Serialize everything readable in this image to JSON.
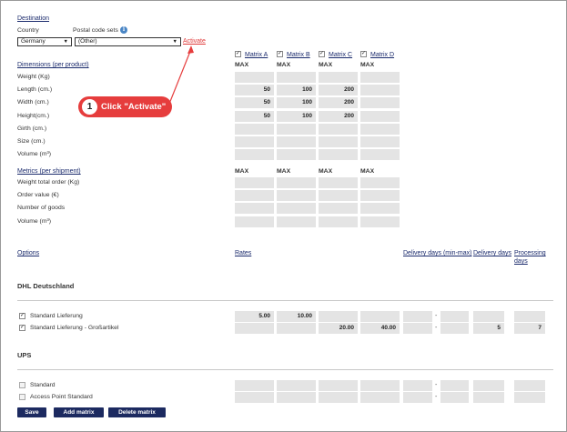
{
  "destination": {
    "title": "Destination",
    "country_label": "Country",
    "postal_label": "Postal code sets",
    "country_value": "Germany",
    "postal_value": "(Other)",
    "activate_link": "Activate",
    "info_icon": "i"
  },
  "callout": {
    "number": "1",
    "text": "Click \"Activate\""
  },
  "matrices": [
    "Matrix A",
    "Matrix B",
    "Matrix C",
    "Matrix D"
  ],
  "max_label": "MAX",
  "dimensions": {
    "title": "Dimensions (per product)",
    "rows": [
      {
        "label": "Weight (Kg)",
        "values": [
          "",
          "",
          "",
          ""
        ]
      },
      {
        "label": "Length (cm.)",
        "values": [
          "50",
          "100",
          "200",
          ""
        ]
      },
      {
        "label": "Width (cm.)",
        "values": [
          "50",
          "100",
          "200",
          ""
        ]
      },
      {
        "label": "Height(cm.)",
        "values": [
          "50",
          "100",
          "200",
          ""
        ]
      },
      {
        "label": "Girth (cm.)",
        "values": [
          "",
          "",
          "",
          ""
        ]
      },
      {
        "label": "Size (cm.)",
        "values": [
          "",
          "",
          "",
          ""
        ]
      },
      {
        "label": "Volume (m³)",
        "values": [
          "",
          "",
          "",
          ""
        ]
      }
    ]
  },
  "metrics": {
    "title": "Metrics (per shipment)",
    "rows": [
      {
        "label": "Weight total order (Kg)",
        "values": [
          "",
          "",
          "",
          ""
        ]
      },
      {
        "label": "Order value (€)",
        "values": [
          "",
          "",
          "",
          ""
        ]
      },
      {
        "label": "Number of goods",
        "values": [
          "",
          "",
          "",
          ""
        ]
      },
      {
        "label": "Volume (m³)",
        "values": [
          "",
          "",
          "",
          ""
        ]
      }
    ]
  },
  "options_header": {
    "options": "Options",
    "rates": "Rates",
    "delivery_min_max": "Delivery days (min-max)",
    "delivery_days": "Delivery days",
    "processing_line1": "Processing",
    "processing_line2": "days"
  },
  "carriers": [
    {
      "name": "DHL Deutschland",
      "services": [
        {
          "label": "Standard Lieferung",
          "checked": true,
          "rates": [
            "5.00",
            "10.00",
            "",
            ""
          ],
          "min": "",
          "max": "",
          "delivery": "",
          "processing": ""
        },
        {
          "label": "Standard Lieferung - Großartikel",
          "checked": true,
          "rates": [
            "",
            "",
            "20.00",
            "40.00"
          ],
          "min": "",
          "max": "",
          "delivery": "5",
          "processing": "7"
        }
      ]
    },
    {
      "name": "UPS",
      "services": [
        {
          "label": "Standard",
          "checked": false,
          "rates": [
            "",
            "",
            "",
            ""
          ],
          "min": "",
          "max": "",
          "delivery": "",
          "processing": ""
        },
        {
          "label": "Access Point Standard",
          "checked": false,
          "rates": [
            "",
            "",
            "",
            ""
          ],
          "min": "",
          "max": "",
          "delivery": "",
          "processing": ""
        }
      ]
    }
  ],
  "dash": "-",
  "check_mark": "✓",
  "buttons": {
    "save": "Save",
    "add_matrix": "Add matrix",
    "delete_matrix": "Delete matrix"
  },
  "colors": {
    "accent": "#1c2a60",
    "callout": "#e63d3d",
    "field": "#e4e4e4"
  }
}
